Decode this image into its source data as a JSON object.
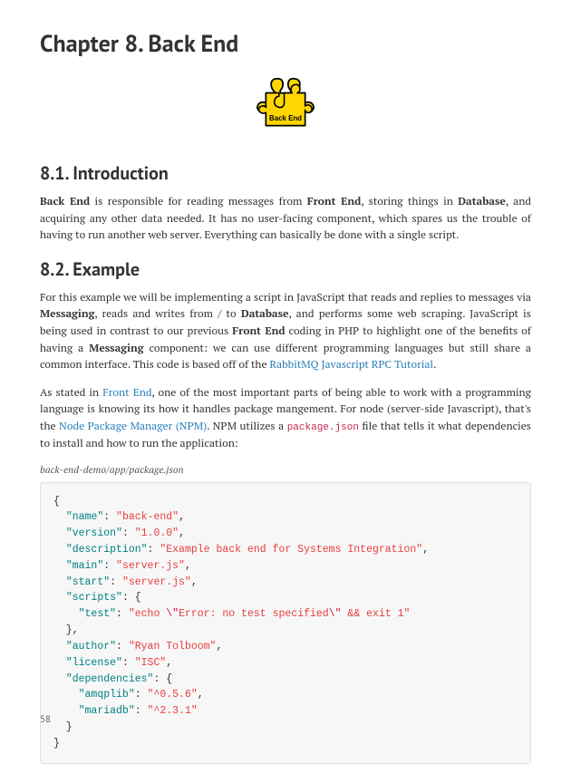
{
  "chapter_title": "Chapter 8. Back End",
  "puzzle_label": "Back End",
  "sections": {
    "intro": {
      "heading": "8.1. Introduction",
      "p1_parts": {
        "b1": "Back End",
        "t1": " is responsible for reading messages from ",
        "b2": "Front End",
        "t2": ", storing things in ",
        "b3": "Database",
        "t3": ", and acquiring any other data needed. It has no user-facing component, which spares us the trouble of having to run another web server. Everything can basically be done with a single script."
      }
    },
    "example": {
      "heading": "8.2. Example",
      "p1_parts": {
        "t1": "For this example we will be implementing a script in JavaScript that reads and replies to messages via ",
        "b1": "Messaging",
        "t2": ", reads and writes from / to ",
        "b2": "Database",
        "t3": ", and performs some web scraping. JavaScript is being used in contrast to our previous ",
        "b3": "Front End",
        "t4": " coding in PHP to highlight one of the benefits of having a ",
        "b4": "Messaging",
        "t5": " component: we can use different programming languages but still share a common interface. This code is based off of the ",
        "link1": "RabbitMQ Javascript RPC Tutorial",
        "t6": "."
      },
      "p2_parts": {
        "t1": "As stated in ",
        "link1": "Front End",
        "t2": ", one of the most important parts of being able to work with a programming language is knowing its how it handles package mangement. For node (server-side Javascript), that's the  ",
        "link2": "Node Package Manager (NPM)",
        "t3": ". NPM utilizes a ",
        "code1": "package.json",
        "t4": " file that tells it what dependencies to install and how to run the application:"
      },
      "caption": "back-end-demo/app/package.json"
    }
  },
  "code": {
    "k_name": "\"name\"",
    "v_name": "\"back-end\"",
    "k_version": "\"version\"",
    "v_version": "\"1.0.0\"",
    "k_description": "\"description\"",
    "v_description": "\"Example back end for Systems Integration\"",
    "k_main": "\"main\"",
    "v_main": "\"server.js\"",
    "k_start": "\"start\"",
    "v_start": "\"server.js\"",
    "k_scripts": "\"scripts\"",
    "k_test": "\"test\"",
    "v_test_a": "\"echo ",
    "v_test_esc1": "\\\"",
    "v_test_b": "Error: no test specified",
    "v_test_esc2": "\\\"",
    "v_test_c": " && exit 1\"",
    "k_author": "\"author\"",
    "v_author": "\"Ryan Tolboom\"",
    "k_license": "\"license\"",
    "v_license": "\"ISC\"",
    "k_deps": "\"dependencies\"",
    "k_amqplib": "\"amqplib\"",
    "v_amqplib": "\"^0.5.6\"",
    "k_mariadb": "\"mariadb\"",
    "v_mariadb": "\"^2.3.1\""
  },
  "page_number": "58"
}
